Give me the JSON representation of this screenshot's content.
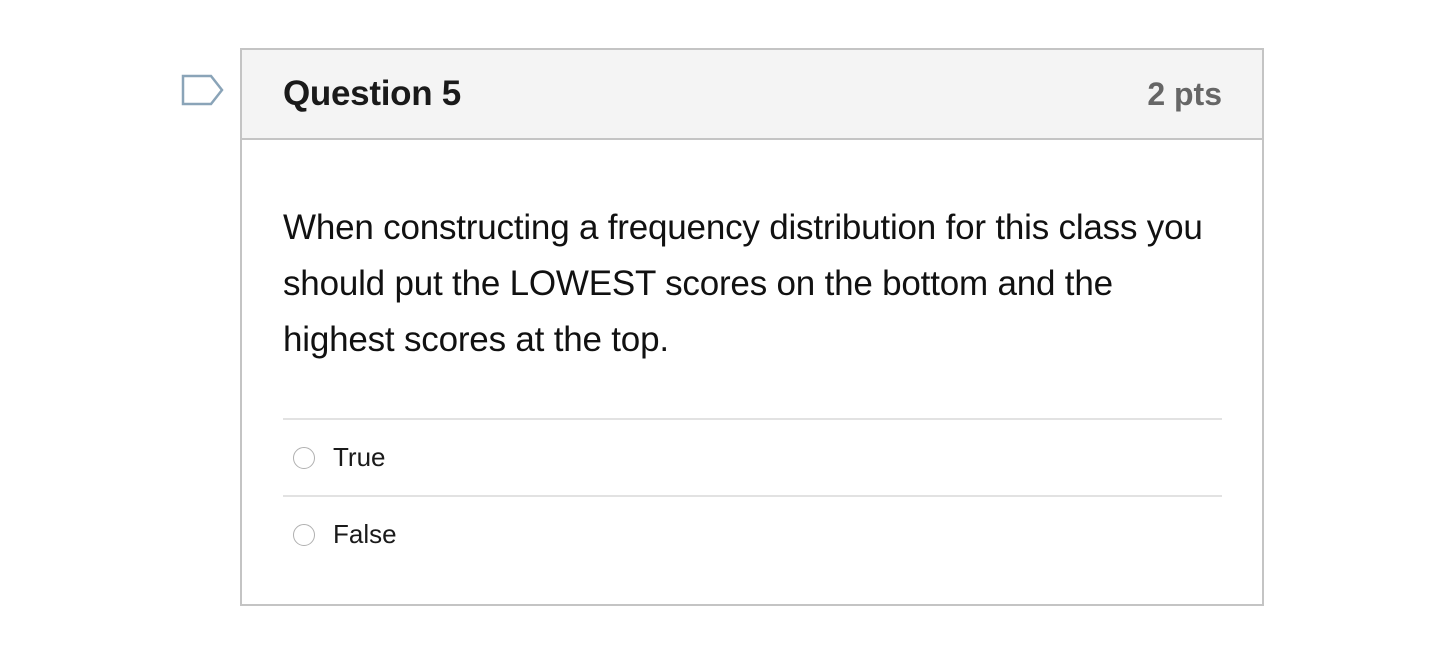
{
  "flag": {
    "icon": "flag-question-icon",
    "color": "#8aa4b8"
  },
  "question": {
    "title": "Question 5",
    "points": "2 pts",
    "text": "When constructing a frequency distribution for this class you should put the LOWEST scores on the bottom and the highest scores at the top.",
    "answers": [
      {
        "label": "True",
        "selected": false
      },
      {
        "label": "False",
        "selected": false
      }
    ]
  }
}
